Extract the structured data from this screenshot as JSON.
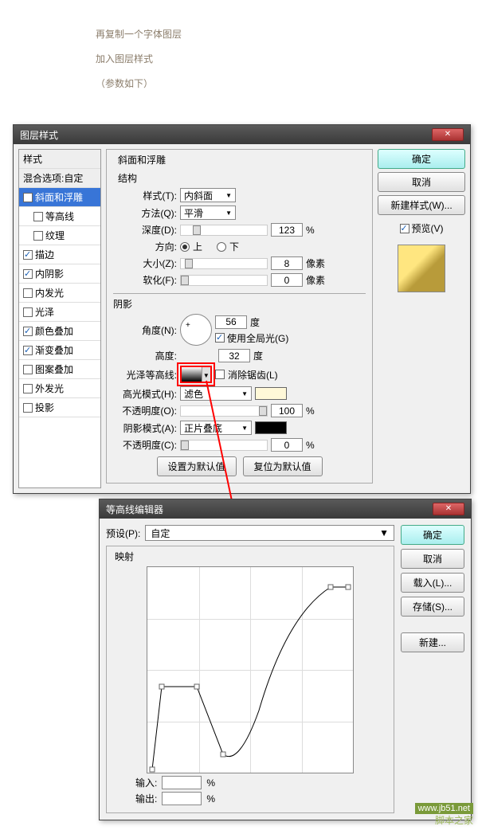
{
  "instruction": {
    "line1": "再复制一个字体图层",
    "line2": "加入图层样式",
    "line3": "（参数如下）"
  },
  "dialog1": {
    "title": "图层样式",
    "styles_header": "样式",
    "blend_header": "混合选项:自定",
    "items": [
      {
        "label": "斜面和浮雕",
        "checked": true,
        "selected": true
      },
      {
        "label": "等高线",
        "checked": false,
        "indent": true
      },
      {
        "label": "纹理",
        "checked": false,
        "indent": true
      },
      {
        "label": "描边",
        "checked": true
      },
      {
        "label": "内阴影",
        "checked": true
      },
      {
        "label": "内发光",
        "checked": false
      },
      {
        "label": "光泽",
        "checked": false
      },
      {
        "label": "颜色叠加",
        "checked": true
      },
      {
        "label": "渐变叠加",
        "checked": true
      },
      {
        "label": "图案叠加",
        "checked": false
      },
      {
        "label": "外发光",
        "checked": false
      },
      {
        "label": "投影",
        "checked": false
      }
    ],
    "bevel": {
      "group_title": "斜面和浮雕",
      "struct_title": "结构",
      "style_label": "样式(T):",
      "style_value": "内斜面",
      "method_label": "方法(Q):",
      "method_value": "平滑",
      "depth_label": "深度(D):",
      "depth_value": "123",
      "depth_unit": "%",
      "direction_label": "方向:",
      "up": "上",
      "down": "下",
      "size_label": "大小(Z):",
      "size_value": "8",
      "size_unit": "像素",
      "soften_label": "软化(F):",
      "soften_value": "0",
      "soften_unit": "像素"
    },
    "shading": {
      "title": "阴影",
      "angle_label": "角度(N):",
      "angle_value": "56",
      "angle_unit": "度",
      "global_label": "使用全局光(G)",
      "altitude_label": "高度:",
      "altitude_value": "32",
      "altitude_unit": "度",
      "gloss_label": "光泽等高线:",
      "antialias_label": "消除锯齿(L)",
      "hilite_mode_label": "高光模式(H):",
      "hilite_mode_value": "滤色",
      "hilite_opacity_label": "不透明度(O):",
      "hilite_opacity_value": "100",
      "pct": "%",
      "shadow_mode_label": "阴影模式(A):",
      "shadow_mode_value": "正片叠底",
      "shadow_opacity_label": "不透明度(C):",
      "shadow_opacity_value": "0"
    },
    "defaults": {
      "set": "设置为默认值",
      "reset": "复位为默认值"
    },
    "buttons": {
      "ok": "确定",
      "cancel": "取消",
      "newstyle": "新建样式(W)...",
      "preview": "预览(V)"
    }
  },
  "dialog2": {
    "title": "等高线编辑器",
    "preset_label": "预设(P):",
    "preset_value": "自定",
    "mapping_title": "映射",
    "input_label": "输入:",
    "output_label": "输出:",
    "pct": "%",
    "buttons": {
      "ok": "确定",
      "cancel": "取消",
      "load": "载入(L)...",
      "save": "存储(S)...",
      "new": "新建..."
    }
  },
  "watermark": {
    "url": "www.jb51.net",
    "name": "脚本之家"
  }
}
